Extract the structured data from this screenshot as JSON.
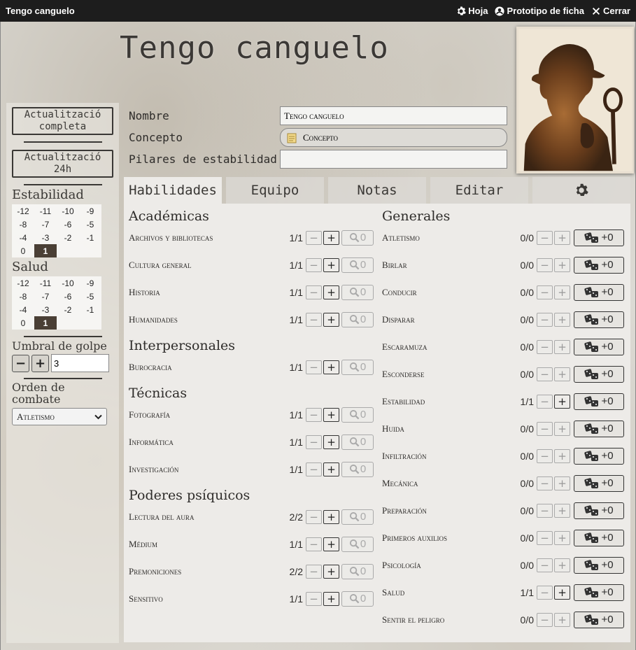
{
  "titlebar": {
    "title": "Tengo canguelo",
    "sheet_label": "Hoja",
    "prototype_label": "Prototipo de ficha",
    "close_label": "Cerrar"
  },
  "character": {
    "name": "Tengo canguelo"
  },
  "left": {
    "update_full": "Actualització completa",
    "update_24h": "Actualització 24h",
    "stability_title": "Estabilidad",
    "stability_track": [
      [
        "-12",
        "-11",
        "-10",
        "-9"
      ],
      [
        "-8",
        "-7",
        "-6",
        "-5"
      ],
      [
        "-4",
        "-3",
        "-2",
        "-1"
      ],
      [
        "0",
        "1"
      ]
    ],
    "stability_active": "1",
    "health_title": "Salud",
    "health_track": [
      [
        "-12",
        "-11",
        "-10",
        "-9"
      ],
      [
        "-8",
        "-7",
        "-6",
        "-5"
      ],
      [
        "-4",
        "-3",
        "-2",
        "-1"
      ],
      [
        "0",
        "1"
      ]
    ],
    "health_active": "1",
    "threshold_title": "Umbral de golpe",
    "threshold_value": "3",
    "combat_title": "Orden de combate",
    "combat_value": "Atletismo"
  },
  "fields": {
    "name_label": "Nombre",
    "name_value": "Tengo canguelo",
    "concept_label": "Concepto",
    "concept_value": "Concepto",
    "pillars_label": "Pilares de estabilidad",
    "pillars_value": ""
  },
  "tabs": [
    "Habilidades",
    "Equipo",
    "Notas",
    "Editar"
  ],
  "academic": {
    "title": "Académicas",
    "skills": [
      {
        "name": "Archivos y bibliotecas",
        "value": "1/1"
      },
      {
        "name": "Cultura general",
        "value": "1/1"
      },
      {
        "name": "Historia",
        "value": "1/1"
      },
      {
        "name": "Humanidades",
        "value": "1/1"
      }
    ]
  },
  "interpersonal": {
    "title": "Interpersonales",
    "skills": [
      {
        "name": "Burocracia",
        "value": "1/1"
      }
    ]
  },
  "technical": {
    "title": "Técnicas",
    "skills": [
      {
        "name": "Fotografía",
        "value": "1/1"
      },
      {
        "name": "Informática",
        "value": "1/1"
      },
      {
        "name": "Investigación",
        "value": "1/1"
      }
    ]
  },
  "psychic": {
    "title": "Poderes psíquicos",
    "skills": [
      {
        "name": "Lectura del aura",
        "value": "2/2"
      },
      {
        "name": "Médium",
        "value": "1/1"
      },
      {
        "name": "Premoniciones",
        "value": "2/2"
      },
      {
        "name": "Sensitivo",
        "value": "1/1"
      }
    ]
  },
  "general": {
    "title": "Generales",
    "skills": [
      {
        "name": "Atletismo",
        "value": "0/0"
      },
      {
        "name": "Birlar",
        "value": "0/0"
      },
      {
        "name": "Conducir",
        "value": "0/0"
      },
      {
        "name": "Disparar",
        "value": "0/0"
      },
      {
        "name": "Escaramuza",
        "value": "0/0"
      },
      {
        "name": "Esconderse",
        "value": "0/0"
      },
      {
        "name": "Estabilidad",
        "value": "1/1"
      },
      {
        "name": "Huida",
        "value": "0/0"
      },
      {
        "name": "Infiltración",
        "value": "0/0"
      },
      {
        "name": "Mecánica",
        "value": "0/0"
      },
      {
        "name": "Preparación",
        "value": "0/0"
      },
      {
        "name": "Primeros auxilios",
        "value": "0/0"
      },
      {
        "name": "Psicología",
        "value": "0/0"
      },
      {
        "name": "Salud",
        "value": "1/1"
      },
      {
        "name": "Sentir el peligro",
        "value": "0/0"
      }
    ]
  },
  "buttons": {
    "minus": "−",
    "plus": "+",
    "search_count": "0",
    "dice_label": "+0"
  },
  "icons": {
    "sheet": "gear-icon",
    "prototype": "user-circle-icon",
    "close": "close-icon",
    "settings_tab": "gear-icon",
    "search": "magnifier-icon",
    "dice": "dice-icon",
    "resize": "resize-icon",
    "notepad": "notepad-icon"
  }
}
